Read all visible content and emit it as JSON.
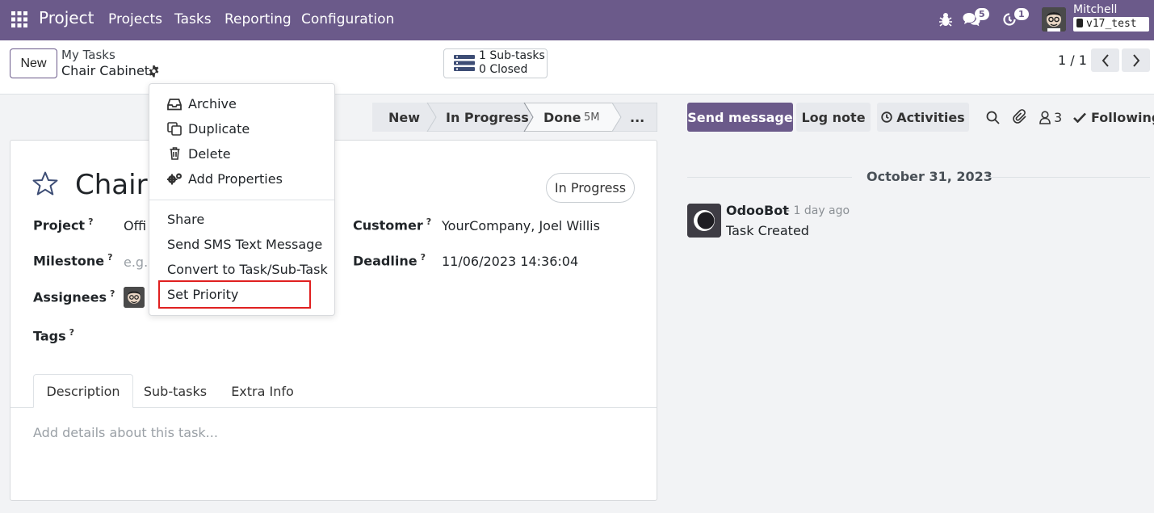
{
  "navbar": {
    "brand": "Project",
    "menu": [
      "Projects",
      "Tasks",
      "Reporting",
      "Configuration"
    ],
    "messages_badge": "5",
    "activities_badge": "1",
    "user_name": "Mitchell Admin",
    "database": "v17_test"
  },
  "control_panel": {
    "new_label": "New",
    "breadcrumb_parent": "My Tasks",
    "breadcrumb_current": "Chair Cabinet",
    "subtasks_count": "1 Sub-tasks",
    "subtasks_closed": "0 Closed",
    "pager": "1 / 1"
  },
  "statusbar": {
    "stages": [
      "New",
      "In Progress",
      "Done"
    ],
    "done_tag": "5M",
    "more": "..."
  },
  "dropdown": {
    "items_top": [
      "Archive",
      "Duplicate",
      "Delete",
      "Add Properties"
    ],
    "items_bottom": [
      "Share",
      "Send SMS Text Message",
      "Convert to Task/Sub-Task",
      "Set Priority"
    ]
  },
  "form": {
    "title": "Chair C",
    "status": "In Progress",
    "help_mark": "?",
    "fields": {
      "project_label": "Project",
      "project_value": "Offi",
      "milestone_label": "Milestone",
      "milestone_placeholder": "e.g.",
      "assignees_label": "Assignees",
      "tags_label": "Tags",
      "customer_label": "Customer",
      "customer_value": "YourCompany, Joel Willis",
      "deadline_label": "Deadline",
      "deadline_value": "11/06/2023 14:36:04"
    },
    "tabs": [
      "Description",
      "Sub-tasks",
      "Extra Info"
    ],
    "description_placeholder": "Add details about this task..."
  },
  "chatter": {
    "send_message": "Send message",
    "log_note": "Log note",
    "activities": "Activities",
    "followers_count": "3",
    "following": "Following",
    "date": "October 31, 2023",
    "message": {
      "author": "OdooBot",
      "time": "- 1 day ago",
      "body": "Task Created"
    }
  },
  "colors": {
    "navbar": "#6b5a8a",
    "primary_button": "#6b5a8a",
    "highlight_box": "#e02020"
  }
}
